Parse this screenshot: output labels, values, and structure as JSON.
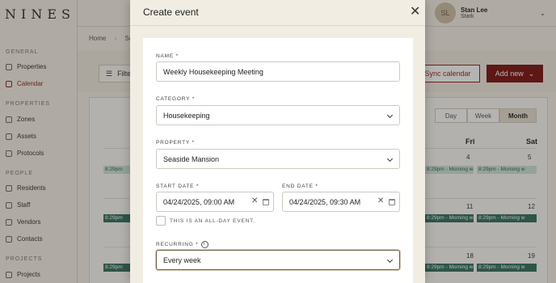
{
  "app": {
    "logo": "NINES",
    "sidebar": {
      "sections": [
        {
          "title": "GENERAL",
          "items": [
            "Properties",
            "Calendar"
          ]
        },
        {
          "title": "PROPERTIES",
          "items": [
            "Zones",
            "Assets",
            "Protocols"
          ]
        },
        {
          "title": "PEOPLE",
          "items": [
            "Residents",
            "Staff",
            "Vendors",
            "Contacts"
          ]
        },
        {
          "title": "PROJECTS",
          "items": [
            "Projects"
          ]
        }
      ],
      "active": "Calendar"
    },
    "user": {
      "initials": "SL",
      "name": "Stan Lee",
      "company": "Stark"
    },
    "breadcrumb": {
      "home": "Home",
      "next": "Se"
    },
    "toolbar": {
      "filter": "Filte",
      "sync": "Sync calendar",
      "add": "Add new"
    },
    "calendar": {
      "views": [
        "Day",
        "Week",
        "Month"
      ],
      "active_view": "Month",
      "day_headers": [
        "Fri",
        "Sat"
      ],
      "day_numbers": [
        "4",
        "5",
        "11",
        "12",
        "18",
        "19"
      ],
      "event_label": "8:29pm - Morning w",
      "event_label_short": "8:29pm"
    }
  },
  "modal": {
    "title": "Create event",
    "name_label": "NAME *",
    "name_value": "Weekly Housekeeping Meeting",
    "category_label": "CATEGORY *",
    "category_value": "Housekeeping",
    "property_label": "PROPERTY *",
    "property_value": "Seaside Mansion",
    "start_label": "START DATE *",
    "start_value": "04/24/2025, 09:00 AM",
    "end_label": "END DATE *",
    "end_value": "04/24/2025, 09:30 AM",
    "all_day_label": "THIS IS AN ALL-DAY EVENT.",
    "all_day_checked": false,
    "recurring_label": "RECURRING *",
    "recurring_value": "Every week"
  },
  "colors": {
    "accent": "#7a1212",
    "event": "#cde4dc",
    "event_dark": "#2f6f5f"
  }
}
